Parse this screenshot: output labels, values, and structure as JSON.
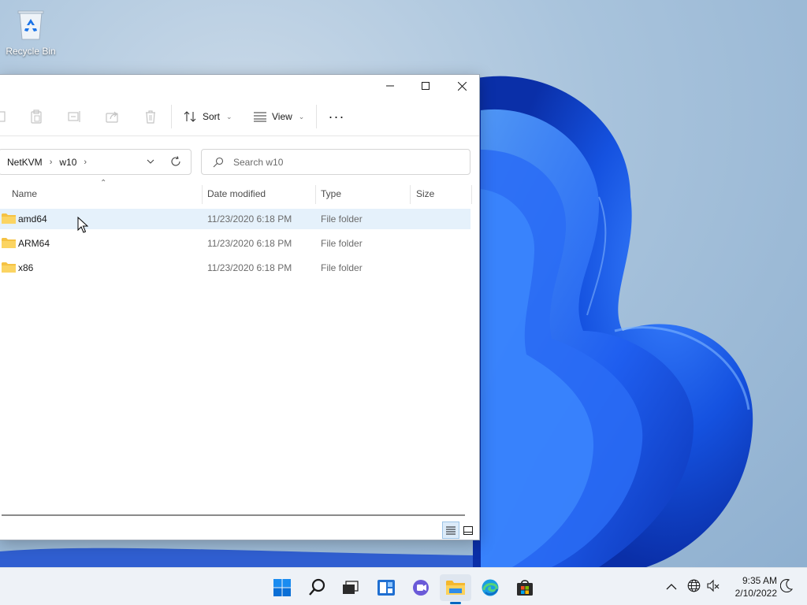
{
  "desktop": {
    "icons": [
      {
        "label": "Recycle Bin",
        "icon": "recycle-bin-icon"
      }
    ]
  },
  "explorer": {
    "toolbar": {
      "sort_label": "Sort",
      "view_label": "View",
      "more_label": "···",
      "disabled_icons": [
        "cut-icon",
        "paste-icon",
        "rename-icon",
        "share-icon",
        "delete-icon"
      ]
    },
    "address": {
      "breadcrumbs": [
        "NetKVM",
        "w10"
      ]
    },
    "search": {
      "placeholder": "Search w10"
    },
    "columns": [
      "Name",
      "Date modified",
      "Type",
      "Size"
    ],
    "rows": [
      {
        "name": "amd64",
        "date": "11/23/2020 6:18 PM",
        "type": "File folder",
        "size": "",
        "selected": true
      },
      {
        "name": "ARM64",
        "date": "11/23/2020 6:18 PM",
        "type": "File folder",
        "size": ""
      },
      {
        "name": "x86",
        "date": "11/23/2020 6:18 PM",
        "type": "File folder",
        "size": ""
      }
    ],
    "view_modes": [
      "details-view-icon",
      "large-icons-view-icon"
    ],
    "active_view": "details-view-icon"
  },
  "taskbar": {
    "apps": [
      "start-icon",
      "search-icon",
      "task-view-icon",
      "widgets-icon",
      "chat-icon",
      "file-explorer-icon",
      "edge-icon",
      "store-icon"
    ],
    "active_app": "file-explorer-icon",
    "tray_icons": [
      "chevron-up-icon",
      "network-icon",
      "volume-muted-icon"
    ],
    "time": "9:35 AM",
    "date": "2/10/2022"
  },
  "colors": {
    "accent": "#0067c0",
    "selection": "#e5f1fb",
    "wallpaper_blue": "#1b55e6",
    "folder": "#f5c243"
  }
}
